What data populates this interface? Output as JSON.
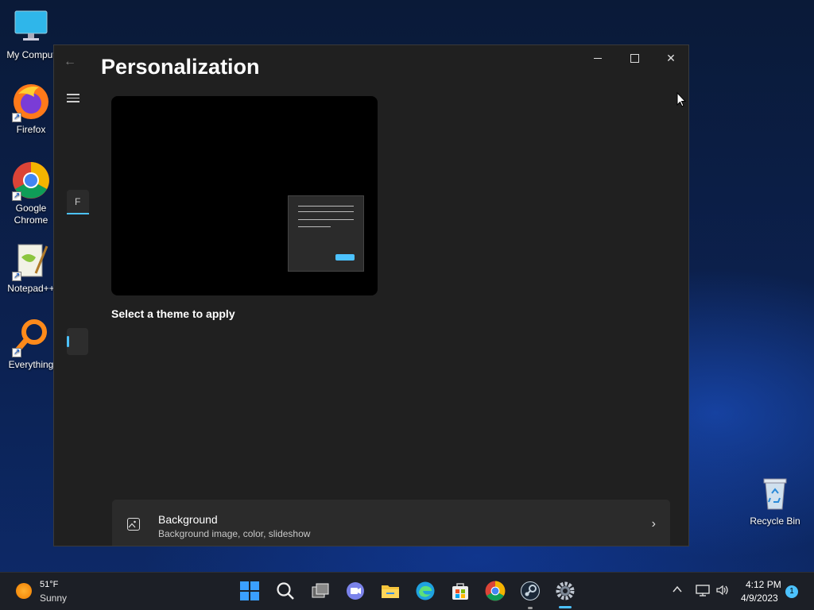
{
  "desktop": {
    "icons": [
      {
        "label": "My Comput",
        "icon": "monitor-icon"
      },
      {
        "label": "Firefox",
        "icon": "firefox-icon"
      },
      {
        "label": "Google Chrome",
        "icon": "chrome-icon"
      },
      {
        "label": "Notepad++",
        "icon": "notepad-plus-plus-icon"
      },
      {
        "label": "Everything",
        "icon": "everything-search-icon"
      },
      {
        "label": "Recycle Bin",
        "icon": "recycle-bin-icon"
      }
    ]
  },
  "window": {
    "title": "Personalization",
    "nav_search_value": "F",
    "preview_caption": "Select a theme to apply",
    "cards": [
      {
        "title": "Background",
        "subtitle": "Background image, color, slideshow",
        "icon": "image-icon"
      }
    ],
    "controls": {
      "minimize": "–",
      "maximize": "□",
      "close": "✕"
    }
  },
  "taskbar": {
    "weather": {
      "temp": "51°F",
      "desc": "Sunny"
    },
    "clock": {
      "time": "4:12 PM",
      "date": "4/9/2023"
    },
    "notification_count": "1",
    "apps": [
      "start",
      "search",
      "task-view",
      "teams-chat",
      "file-explorer",
      "edge",
      "store",
      "chrome",
      "steam",
      "settings"
    ]
  },
  "colors": {
    "accent": "#4cc2ff",
    "window_bg": "#202020",
    "card_bg": "#2b2b2b"
  }
}
